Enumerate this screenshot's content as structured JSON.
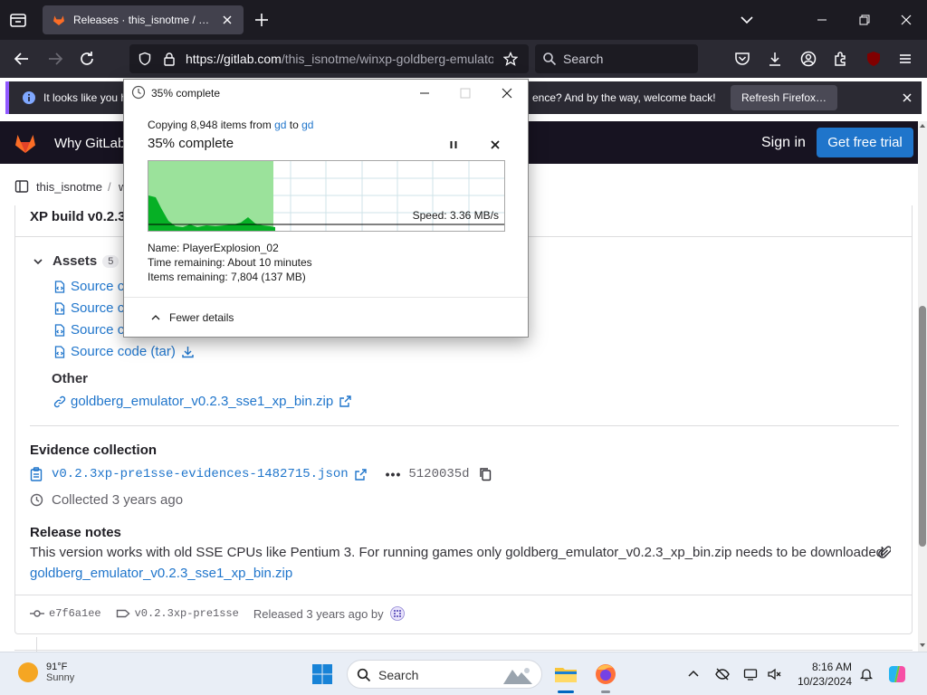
{
  "browser": {
    "tab_title": "Releases · this_isnotme / winxp-goldberg-emulator",
    "url_host": "https://gitlab.com",
    "url_path": "/this_isnotme/winxp-goldberg-emulator/-/releases",
    "search_placeholder": "Search",
    "extension_badge": "15",
    "notification_left": "It looks like you h",
    "notification_right": "ence? And by the way, welcome back!",
    "refresh_button": "Refresh Firefox…"
  },
  "gitlab": {
    "nav_why": "Why GitLab",
    "sign_in": "Sign in",
    "free_trial": "Get free trial",
    "breadcrumb_user": "this_isnotme",
    "breadcrumb_sep": "/",
    "breadcrumb_project": "w",
    "release_title": "XP build v0.2.3",
    "assets_label": "Assets",
    "assets_count": "5",
    "assets": [
      {
        "label": "Source c"
      },
      {
        "label": "Source c"
      },
      {
        "label": "Source c"
      },
      {
        "label": "Source code (tar)"
      }
    ],
    "other_label": "Other",
    "other_link": "goldberg_emulator_v0.2.3_sse1_xp_bin.zip",
    "evidence_label": "Evidence collection",
    "evidence_file": "v0.2.3xp-pre1sse-evidences-1482715.json",
    "evidence_dots": "•••",
    "evidence_sha": "5120035d",
    "collected": "Collected 3 years ago",
    "notes_label": "Release notes",
    "notes_text": "This version works with old SSE CPUs like Pentium 3. For running games only goldberg_emulator_v0.2.3_xp_bin.zip needs to be downloaded.",
    "notes_link": "goldberg_emulator_v0.2.3_sse1_xp_bin.zip",
    "footer_commit": "e7f6a1ee",
    "footer_tag": "v0.2.3xp-pre1sse",
    "footer_released": "Released 3 years ago by"
  },
  "dialog": {
    "title": "35% complete",
    "copying_prefix": "Copying 8,948 items from ",
    "copying_src": "gd",
    "copying_mid": " to ",
    "copying_dst": "gd",
    "percent_label": "35% complete",
    "progress": 0.35,
    "speed": "Speed: 3.36 MB/s",
    "name": "Name:  PlayerExplosion_02",
    "time_remaining": "Time remaining:  About 10 minutes",
    "items_remaining": "Items remaining:  7,804 (137 MB)",
    "fewer_details": "Fewer details"
  },
  "taskbar": {
    "temp": "91°F",
    "condition": "Sunny",
    "search_label": "Search",
    "time": "8:16 AM",
    "date": "10/23/2024"
  },
  "colors": {
    "gitlab_blue": "#1f75cb",
    "progress_green": "#9be29b",
    "graph_green": "#06b025"
  }
}
